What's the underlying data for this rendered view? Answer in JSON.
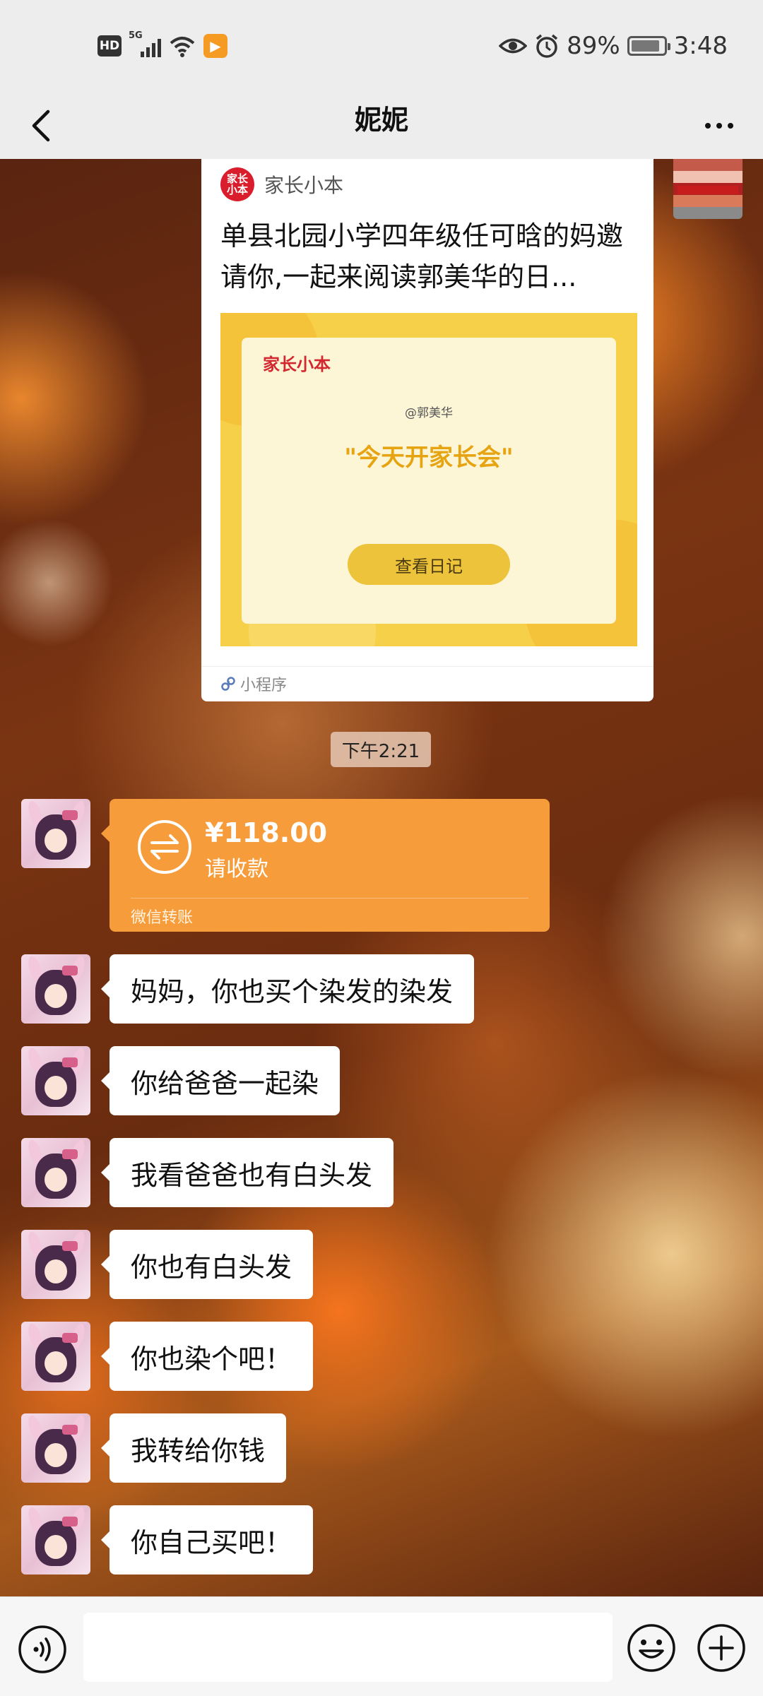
{
  "status_bar": {
    "hd": "HD",
    "network": "5G",
    "battery": "89%",
    "battery_level": 0.89,
    "time": "3:48"
  },
  "header": {
    "title": "妮妮",
    "back_icon": "chevron-left-icon",
    "more_icon": "more-dots-icon"
  },
  "mini_program_card": {
    "app_logo_text": "家长\n小本",
    "app_name": "家长小本",
    "title": "单县北园小学四年级任可晗的妈邀请你,一起来阅读郭美华的日...",
    "thumb_brand": "家长小本",
    "thumb_author": "@郭美华",
    "thumb_quote": "\"今天开家长会\"",
    "thumb_button": "查看日记",
    "footer_label": "小程序"
  },
  "timestamp": "下午2:21",
  "transfer": {
    "amount": "¥118.00",
    "status": "请收款",
    "footer": "微信转账"
  },
  "messages": [
    {
      "text": "妈妈，你也买个染发的染发"
    },
    {
      "text": "你给爸爸一起染"
    },
    {
      "text": "我看爸爸也有白头发"
    },
    {
      "text": "你也有白头发"
    },
    {
      "text": "你也染个吧！"
    },
    {
      "text": "我转给你钱"
    },
    {
      "text": "你自己买吧！"
    }
  ],
  "input_bar": {
    "voice_icon": "voice-icon",
    "emoji_icon": "emoji-icon",
    "plus_icon": "plus-icon",
    "placeholder": ""
  },
  "colors": {
    "topbar_bg": "#ededed",
    "transfer_bg": "#f79c3a",
    "card_logo": "#d91d2c",
    "thumb_bg": "#f7d04a"
  }
}
